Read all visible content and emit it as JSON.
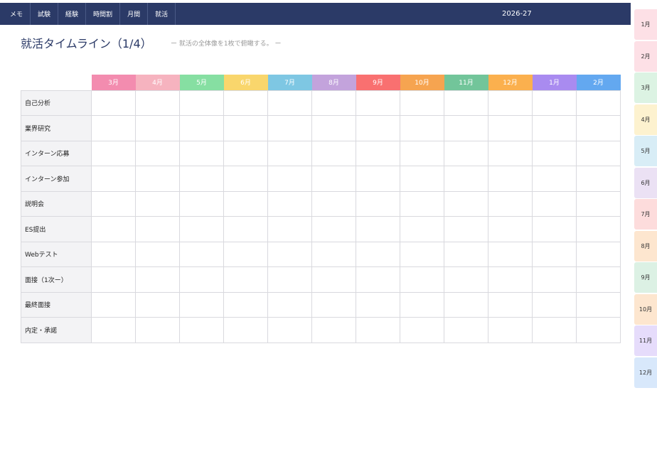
{
  "nav": {
    "items": [
      "メモ",
      "試験",
      "経験",
      "時間割",
      "月間",
      "就活"
    ],
    "year": "2026-27"
  },
  "header": {
    "title": "就活タイムライン（1/4）",
    "subtitle": "ー 就活の全体像を1枚で俯瞰する。 ー"
  },
  "timeline": {
    "months": [
      {
        "label": "3月",
        "color": "#f38caf"
      },
      {
        "label": "4月",
        "color": "#f6b3bf"
      },
      {
        "label": "5月",
        "color": "#86dfa2"
      },
      {
        "label": "6月",
        "color": "#f9d66c"
      },
      {
        "label": "7月",
        "color": "#7ec7e3"
      },
      {
        "label": "8月",
        "color": "#c3a3dc"
      },
      {
        "label": "9月",
        "color": "#f97070"
      },
      {
        "label": "10月",
        "color": "#f6a450"
      },
      {
        "label": "11月",
        "color": "#72c59a"
      },
      {
        "label": "12月",
        "color": "#fbb04e"
      },
      {
        "label": "1月",
        "color": "#a98bf0"
      },
      {
        "label": "2月",
        "color": "#63a8f0"
      }
    ],
    "rows": [
      "自己分析",
      "業界研究",
      "インターン応募",
      "インターン参加",
      "説明会",
      "ES提出",
      "Webテスト",
      "面接（1次ー）",
      "最終面接",
      "内定・承諾"
    ]
  },
  "side_tabs": [
    {
      "label": "1月",
      "color": "#fde0e6"
    },
    {
      "label": "2月",
      "color": "#fde0e6"
    },
    {
      "label": "3月",
      "color": "#dcf3e3"
    },
    {
      "label": "4月",
      "color": "#fdf2cf"
    },
    {
      "label": "5月",
      "color": "#d8edf6"
    },
    {
      "label": "6月",
      "color": "#ebe1f4"
    },
    {
      "label": "7月",
      "color": "#fddcdc"
    },
    {
      "label": "8月",
      "color": "#fde6cf"
    },
    {
      "label": "9月",
      "color": "#dcf1e4"
    },
    {
      "label": "10月",
      "color": "#fde6cf"
    },
    {
      "label": "11月",
      "color": "#e6dcfb"
    },
    {
      "label": "12月",
      "color": "#d8e8fb"
    }
  ]
}
